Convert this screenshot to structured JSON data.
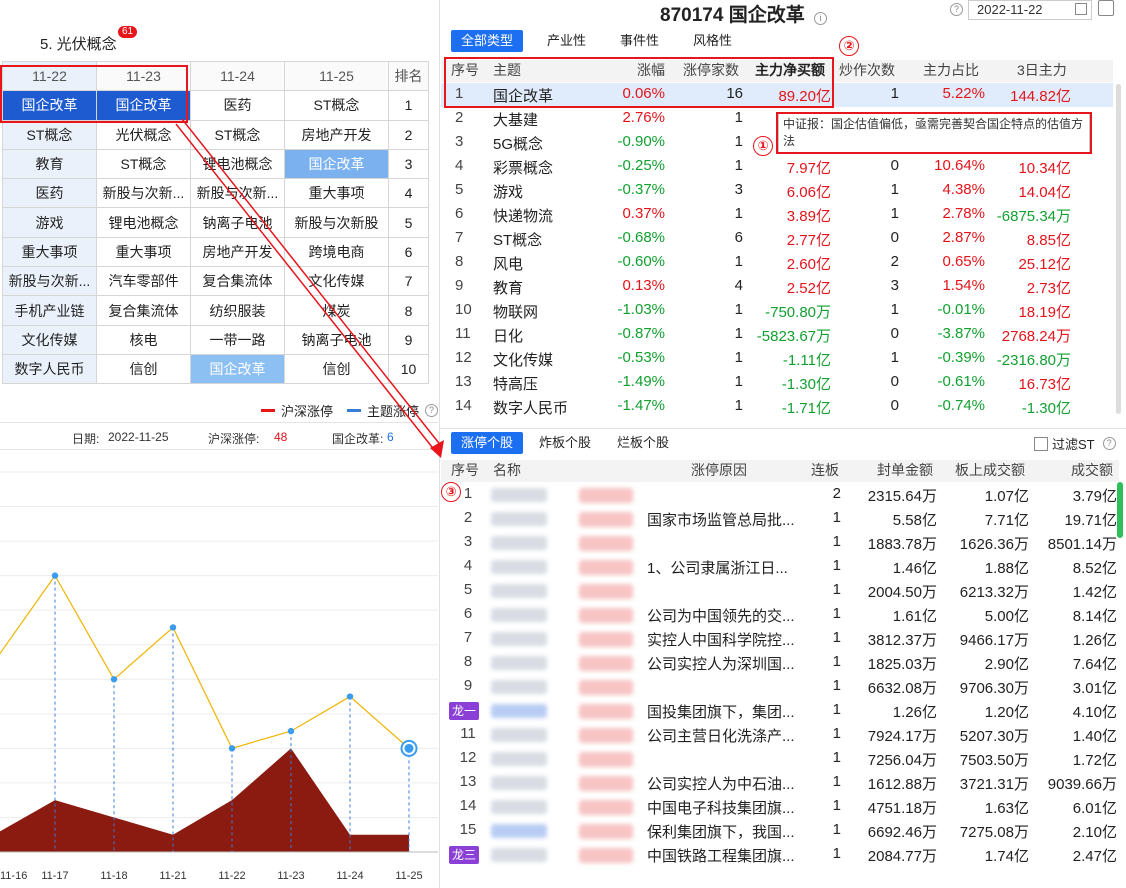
{
  "left": {
    "title": "5. 光伏概念",
    "badge": "61",
    "rank_table": {
      "headers": [
        "11-22",
        "11-23",
        "11-24",
        "11-25",
        "排名"
      ],
      "rows": [
        [
          "国企改革",
          "国企改革",
          "医药",
          "ST概念",
          "1"
        ],
        [
          "ST概念",
          "光伏概念",
          "ST概念",
          "房地产开发",
          "2"
        ],
        [
          "教育",
          "ST概念",
          "锂电池概念",
          "国企改革",
          "3"
        ],
        [
          "医药",
          "新股与次新...",
          "新股与次新...",
          "重大事项",
          "4"
        ],
        [
          "游戏",
          "锂电池概念",
          "钠离子电池",
          "新股与次新股",
          "5"
        ],
        [
          "重大事项",
          "重大事项",
          "房地产开发",
          "跨境电商",
          "6"
        ],
        [
          "新股与次新...",
          "汽车零部件",
          "复合集流体",
          "文化传媒",
          "7"
        ],
        [
          "手机产业链",
          "复合集流体",
          "纺织服装",
          "煤炭",
          "8"
        ],
        [
          "文化传媒",
          "核电",
          "一带一路",
          "钠离子电池",
          "9"
        ],
        [
          "数字人民币",
          "信创",
          "国企改革",
          "信创",
          "10"
        ]
      ]
    },
    "legend": {
      "market": "沪深涨停",
      "theme": "主题涨停",
      "market_color": "#e8151b",
      "theme_color": "#3a7bd5"
    },
    "info_bar": {
      "date_label": "日期:",
      "date_value": "2022-11-25",
      "market_label": "沪深涨停:",
      "market_value": "48",
      "theme_label": "国企改革:",
      "theme_value": "6"
    }
  },
  "chart_data": {
    "type": "line",
    "x": [
      "11-16",
      "11-17",
      "11-18",
      "11-21",
      "11-22",
      "11-23",
      "11-24",
      "11-25"
    ],
    "series": [
      {
        "name": "主题涨停",
        "values": [
          11,
          16,
          10,
          13,
          6,
          7,
          9,
          6
        ]
      },
      {
        "name": "沪深涨停",
        "values": [
          1,
          3,
          2,
          1,
          3,
          6,
          1,
          1
        ]
      }
    ],
    "title": "",
    "xlabel": "",
    "ylabel": "",
    "ylim": [
      0,
      22
    ],
    "colors": [
      "#f0b400",
      "#8b1a10"
    ],
    "grid": "horizontal"
  },
  "right": {
    "code": "870174",
    "name": "国企改革",
    "date": "2022-11-22",
    "tabs": [
      "全部类型",
      "产业性",
      "事件性",
      "风格性"
    ],
    "grid_headers": [
      "序号",
      "主题",
      "涨幅",
      "涨停家数",
      "主力净买额",
      "炒作次数",
      "主力占比",
      "3日主力"
    ],
    "grid_rows": [
      [
        "1",
        "国企改革",
        "0.06%",
        "16",
        "89.20亿",
        "1",
        "5.22%",
        "144.82亿"
      ],
      [
        "2",
        "大基建",
        "2.76%",
        "1",
        "",
        "",
        "",
        ""
      ],
      [
        "3",
        "5G概念",
        "-0.90%",
        "1",
        "",
        "",
        "",
        ""
      ],
      [
        "4",
        "彩票概念",
        "-0.25%",
        "1",
        "7.97亿",
        "0",
        "10.64%",
        "10.34亿"
      ],
      [
        "5",
        "游戏",
        "-0.37%",
        "3",
        "6.06亿",
        "1",
        "4.38%",
        "14.04亿"
      ],
      [
        "6",
        "快递物流",
        "0.37%",
        "1",
        "3.89亿",
        "1",
        "2.78%",
        "-6875.34万"
      ],
      [
        "7",
        "ST概念",
        "-0.68%",
        "6",
        "2.77亿",
        "0",
        "2.87%",
        "8.85亿"
      ],
      [
        "8",
        "风电",
        "-0.60%",
        "1",
        "2.60亿",
        "2",
        "0.65%",
        "25.12亿"
      ],
      [
        "9",
        "教育",
        "0.13%",
        "4",
        "2.52亿",
        "3",
        "1.54%",
        "2.73亿"
      ],
      [
        "10",
        "物联网",
        "-1.03%",
        "1",
        "-750.80万",
        "1",
        "-0.01%",
        "18.19亿"
      ],
      [
        "11",
        "日化",
        "-0.87%",
        "1",
        "-5823.67万",
        "0",
        "-3.87%",
        "2768.24万"
      ],
      [
        "12",
        "文化传媒",
        "-0.53%",
        "1",
        "-1.11亿",
        "1",
        "-0.39%",
        "-2316.80万"
      ],
      [
        "13",
        "特高压",
        "-1.49%",
        "1",
        "-1.30亿",
        "0",
        "-0.61%",
        "16.73亿"
      ],
      [
        "14",
        "数字人民币",
        "-1.47%",
        "1",
        "-1.71亿",
        "0",
        "-0.74%",
        "-1.30亿"
      ]
    ],
    "tooltip": "中证报：国企估值偏低，亟需完善契合国企特点的估值方法",
    "markers": [
      "①",
      "②",
      "③"
    ],
    "sub_tabs": [
      "涨停个股",
      "炸板个股",
      "烂板个股"
    ],
    "filter_label": "过滤ST",
    "bottom_headers": [
      "序号",
      "名称",
      "涨停原因",
      "连板",
      "封单金额",
      "板上成交额",
      "成交额"
    ],
    "bottom_rows": [
      [
        "1",
        "",
        "2",
        "2315.64万",
        "1.07亿",
        "3.79亿"
      ],
      [
        "2",
        "国家市场监管总局批...",
        "1",
        "5.58亿",
        "7.71亿",
        "19.71亿"
      ],
      [
        "3",
        "",
        "1",
        "1883.78万",
        "1626.36万",
        "8501.14万"
      ],
      [
        "4",
        "1、公司隶属浙江日...",
        "1",
        "1.46亿",
        "1.88亿",
        "8.52亿"
      ],
      [
        "5",
        "",
        "1",
        "2004.50万",
        "6213.32万",
        "1.42亿"
      ],
      [
        "6",
        "公司为中国领先的交...",
        "1",
        "1.61亿",
        "5.00亿",
        "8.14亿"
      ],
      [
        "7",
        "实控人中国科学院控...",
        "1",
        "3812.37万",
        "9466.17万",
        "1.26亿"
      ],
      [
        "8",
        "公司实控人为深圳国...",
        "1",
        "1825.03万",
        "2.90亿",
        "7.64亿"
      ],
      [
        "9",
        "",
        "1",
        "6632.08万",
        "9706.30万",
        "3.01亿"
      ],
      [
        "龙一",
        "国投集团旗下，集团...",
        "1",
        "1.26亿",
        "1.20亿",
        "4.10亿"
      ],
      [
        "11",
        "公司主营日化洗涤产...",
        "1",
        "7924.17万",
        "5207.30万",
        "1.40亿"
      ],
      [
        "12",
        "",
        "1",
        "7256.04万",
        "7503.50万",
        "1.72亿"
      ],
      [
        "13",
        "公司实控人为中石油...",
        "1",
        "1612.88万",
        "3721.31万",
        "9039.66万"
      ],
      [
        "14",
        "中国电子科技集团旗...",
        "1",
        "4751.18万",
        "1.63亿",
        "6.01亿"
      ],
      [
        "15",
        "保利集团旗下，我国...",
        "1",
        "6692.46万",
        "7275.08万",
        "2.10亿"
      ],
      [
        "龙三",
        "中国铁路工程集团旗...",
        "1",
        "2084.77万",
        "1.74亿",
        "2.47亿"
      ]
    ]
  }
}
